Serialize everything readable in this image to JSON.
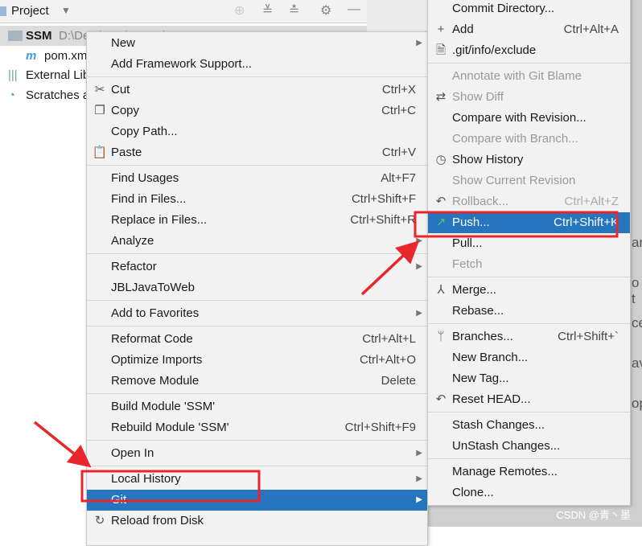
{
  "project_panel": {
    "title": "Project",
    "tree": [
      {
        "name": "SSM",
        "path": "D:\\De...\\Workspace\\SSM"
      },
      {
        "name": "pom.xml"
      },
      {
        "name": "External Libraries"
      },
      {
        "name": "Scratches and Consoles"
      }
    ]
  },
  "context_menu": [
    {
      "label": "New",
      "submenu": true
    },
    {
      "label": "Add Framework Support..."
    },
    {
      "sep": true
    },
    {
      "label": "Cut",
      "shortcut": "Ctrl+X",
      "icon": "scissors-icon"
    },
    {
      "label": "Copy",
      "shortcut": "Ctrl+C",
      "icon": "copy-icon"
    },
    {
      "label": "Copy Path..."
    },
    {
      "label": "Paste",
      "shortcut": "Ctrl+V",
      "icon": "clipboard-icon"
    },
    {
      "sep": true
    },
    {
      "label": "Find Usages",
      "shortcut": "Alt+F7"
    },
    {
      "label": "Find in Files...",
      "shortcut": "Ctrl+Shift+F"
    },
    {
      "label": "Replace in Files...",
      "shortcut": "Ctrl+Shift+R"
    },
    {
      "label": "Analyze",
      "submenu": true
    },
    {
      "sep": true
    },
    {
      "label": "Refactor",
      "submenu": true
    },
    {
      "label": "JBLJavaToWeb"
    },
    {
      "sep": true
    },
    {
      "label": "Add to Favorites",
      "submenu": true
    },
    {
      "sep": true
    },
    {
      "label": "Reformat Code",
      "shortcut": "Ctrl+Alt+L"
    },
    {
      "label": "Optimize Imports",
      "shortcut": "Ctrl+Alt+O"
    },
    {
      "label": "Remove Module",
      "shortcut": "Delete"
    },
    {
      "sep": true
    },
    {
      "label": "Build Module 'SSM'"
    },
    {
      "label": "Rebuild Module 'SSM'",
      "shortcut": "Ctrl+Shift+F9"
    },
    {
      "sep": true
    },
    {
      "label": "Open In",
      "submenu": true
    },
    {
      "sep": true
    },
    {
      "label": "Local History",
      "submenu": true
    },
    {
      "label": "Git",
      "submenu": true,
      "selected": true
    },
    {
      "label": "Reload from Disk",
      "icon": "reload-icon"
    }
  ],
  "git_menu": [
    {
      "label": "Commit Directory..."
    },
    {
      "label": "Add",
      "shortcut": "Ctrl+Alt+A",
      "icon": "plus-icon"
    },
    {
      "label": ".git/info/exclude",
      "icon": "file-ignore-icon"
    },
    {
      "sep": true
    },
    {
      "label": "Annotate with Git Blame",
      "disabled": true
    },
    {
      "label": "Show Diff",
      "disabled": true,
      "icon": "diff-icon"
    },
    {
      "label": "Compare with Revision..."
    },
    {
      "label": "Compare with Branch...",
      "disabled": true
    },
    {
      "label": "Show History",
      "icon": "clock-icon"
    },
    {
      "label": "Show Current Revision",
      "disabled": true
    },
    {
      "label": "Rollback...",
      "shortcut": "Ctrl+Alt+Z",
      "disabled": true,
      "icon": "undo-icon"
    },
    {
      "label": "Push...",
      "shortcut": "Ctrl+Shift+K",
      "selected": true,
      "icon": "push-arrow-icon"
    },
    {
      "label": "Pull..."
    },
    {
      "label": "Fetch",
      "disabled": true
    },
    {
      "sep": true
    },
    {
      "label": "Merge...",
      "icon": "merge-icon"
    },
    {
      "label": "Rebase..."
    },
    {
      "sep": true
    },
    {
      "label": "Branches...",
      "shortcut": "Ctrl+Shift+`",
      "icon": "branch-icon"
    },
    {
      "label": "New Branch..."
    },
    {
      "label": "New Tag..."
    },
    {
      "label": "Reset HEAD...",
      "icon": "undo-icon"
    },
    {
      "sep": true
    },
    {
      "label": "Stash Changes..."
    },
    {
      "label": "UnStash Changes..."
    },
    {
      "sep": true
    },
    {
      "label": "Manage Remotes..."
    },
    {
      "label": "Clone..."
    }
  ],
  "background_fragments": [
    "ar",
    "o t",
    "ce",
    "av",
    "op"
  ],
  "watermark": "CSDN @青丶墨",
  "colors": {
    "selection": "#2675bf",
    "annotation": "#e8262b",
    "menu_bg": "#f2f2f2"
  }
}
